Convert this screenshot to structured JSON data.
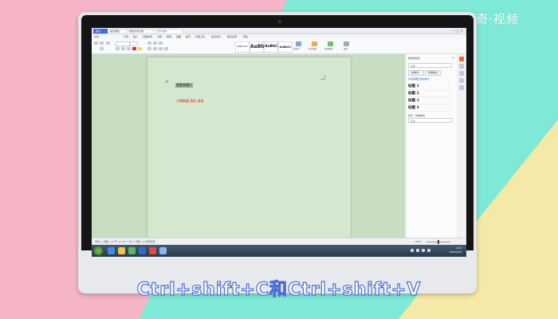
{
  "brand": {
    "logo_text": "天奇·视频",
    "colors": {
      "pink": "#f5b5c6",
      "mint": "#7ee9d6",
      "yellow": "#f4e9a6",
      "caption_outline": "#4b6fd6"
    }
  },
  "caption": "Ctrl+shift+C和Ctrl+shift+V",
  "app": {
    "tabs": [
      {
        "label": "首页",
        "icon": "home-icon"
      },
      {
        "label": "稻壳模板",
        "icon": "template-icon"
      },
      {
        "label": "新建文字文档",
        "icon": "doc-icon"
      },
      {
        "label": "文字文档1",
        "icon": "doc-icon"
      }
    ],
    "menu": [
      "文件",
      "开始",
      "插入",
      "页面布局",
      "引用",
      "审阅",
      "视图",
      "章节",
      "开发工具",
      "会员专享",
      "稻壳资源",
      "查找"
    ],
    "active_menu": "开始",
    "toolbar": {
      "styles": [
        "AaBbCcDd",
        "AaBb",
        "AaBbC",
        "AaBbCc"
      ],
      "style_labels": [
        "正文",
        "标题 1",
        "标题 2",
        "标题 3"
      ],
      "buttons": [
        "新样式",
        "文字排版",
        "查找替换",
        "选择"
      ]
    },
    "document": {
      "selected_text": "我是亲懂人",
      "red_text": "卡牌联盟 我的 游戏"
    },
    "panel": {
      "title": "样式和格式",
      "current_style": "正文",
      "new_style_button": "新样式...",
      "clear_button": "清除格式",
      "link": "请选择要应用的格式",
      "headings": [
        "标题 1",
        "标题 2",
        "标题 3",
        "标题 4"
      ],
      "show_label": "显示：有效样式",
      "show_value": "正文"
    },
    "status": {
      "text": "页码: 1  页面: 1/1  节: 1/1  行: 1  列: 1  字数: 13  拼写检查",
      "zoom": "100%"
    },
    "taskbar": {
      "time": "9:32",
      "date": "2020/6/18"
    }
  }
}
